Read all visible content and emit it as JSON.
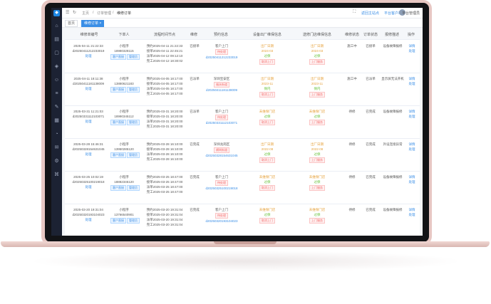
{
  "topbar": {
    "crumb_home": "主页",
    "crumb_sep": "/",
    "crumb_section": "订单管理",
    "crumb_page": "维修订单",
    "right_link_1": "返回主站点",
    "right_link_2": "平台客户端",
    "username": "平台管理员"
  },
  "tabs": [
    {
      "label": "首页"
    },
    {
      "label": "维修订单 ×"
    }
  ],
  "table": {
    "headers": [
      "维修单编号",
      "下单人",
      "流程时间节点",
      "维修",
      "预约信息",
      "设备出厂维保信息",
      "送修门店维保信息",
      "维修状态",
      "订单状态",
      "报修描述",
      "操作"
    ],
    "rows": [
      {
        "order": [
          "2025-04-11 21:22:33",
          "d20250411212233019",
          "处理"
        ],
        "user": [
          "小程序",
          "18980328115",
          "客户直接",
          "管理员"
        ],
        "times": [
          "预约2025-04-11 21:22:33",
          "接单2025-04-11 22:45:21",
          "派单2025-04-12 09:12:10",
          "完工2025-04-12 18:30:02"
        ],
        "repair": "已接单",
        "appt": [
          "客户上门",
          "待处理",
          "d20250411212233019"
        ],
        "factory": [
          "出厂日期",
          "2024-03",
          "过保",
          "取消上门"
        ],
        "store": [
          "出厂日期",
          "2024-03",
          "过保",
          "上门服务"
        ],
        "status": "施工中",
        "ostate": "已接单",
        "desc": "设备故障报修",
        "ops": [
          "详情",
          "处理"
        ]
      },
      {
        "order": [
          "2025-04-11 18:11:38",
          "d20250411181138009",
          "处理"
        ],
        "user": [
          "小程序",
          "13880621183",
          "客户直接",
          "管理员"
        ],
        "times": [
          "预约2025-04-05 18:17:00",
          "接单2025-04-05 18:17:00",
          "派单2025-04-05 18:17:00",
          "完工2025-04-05 18:17:00"
        ],
        "repair": "已派单",
        "appt": [
          "深圳宝安区",
          "福永街道",
          "d20250411181138009"
        ],
        "factory": [
          "出厂日期",
          "2023-11",
          "保内",
          "取消上门"
        ],
        "store": [
          "出厂日期",
          "2023-11",
          "保内",
          "上门服务"
        ],
        "status": "施工中",
        "ostate": "已派单",
        "desc": "显示屏无法开机",
        "ops": [
          "详情",
          "处理"
        ]
      },
      {
        "order": [
          "2025-03-31 11:21:03",
          "d20250331112103071",
          "处理"
        ],
        "user": [
          "小程序",
          "18990345112",
          "客户直接",
          "管理员"
        ],
        "times": [
          "预约2025-03-31 18:20:00",
          "接单2025-03-31 18:20:00",
          "派单2025-03-31 18:20:00",
          "完工2025-03-31 18:20:00"
        ],
        "repair": "已派单",
        "appt": [
          "客户上门",
          "待处理",
          "d20250331112103071"
        ],
        "factory": [
          "未维保门店",
          "过保",
          "取消上门"
        ],
        "store": [
          "未维保门店",
          "过保",
          "上门服务"
        ],
        "status": "待修",
        "ostate": "已完成",
        "desc": "设备故障报修",
        "ops": [
          "详情",
          "处理"
        ]
      },
      {
        "order": [
          "2025-03-28 15:46:31",
          "d20250328154631045",
          "处理"
        ],
        "user": [
          "小程序",
          "13950285120",
          "客户直接",
          "管理员"
        ],
        "times": [
          "预约2025-03-28 16:10:00",
          "接单2025-03-28 16:10:00",
          "派单2025-03-28 16:10:00",
          "完工2025-03-28 16:10:00"
        ],
        "repair": "已完成",
        "appt": [
          "深圳龙岗区",
          "横岗街道",
          "d20250328154631045"
        ],
        "factory": [
          "出厂日期",
          "2022-08",
          "过保",
          "取消上门"
        ],
        "store": [
          "出厂日期",
          "2022-08",
          "过保",
          "上门服务"
        ],
        "status": "待修",
        "ostate": "已完成",
        "desc": "外设连接异常",
        "ops": [
          "详情",
          "处理"
        ]
      },
      {
        "order": [
          "2025-03-25 10:02:19",
          "d20250325100219018",
          "处理"
        ],
        "user": [
          "小程序",
          "18882345120",
          "客户直接",
          "管理员"
        ],
        "times": [
          "预约2025-03-25 18:47:00",
          "接单2025-03-25 18:47:00",
          "派单2025-03-25 18:47:00",
          "完工2025-03-25 18:47:00"
        ],
        "repair": "已完成",
        "appt": [
          "客户上门",
          "待处理",
          "d20250325100219018"
        ],
        "factory": [
          "未维保门店",
          "过保",
          "取消上门"
        ],
        "store": [
          "未维保门店",
          "过保",
          "上门服务"
        ],
        "status": "待修",
        "ostate": "已完成",
        "desc": "设备故障报修",
        "ops": [
          "详情",
          "处理"
        ]
      },
      {
        "order": [
          "2025-03-20 19:31:04",
          "d20250320193104023",
          "处理"
        ],
        "user": [
          "小程序",
          "13766540901",
          "客户直接",
          "管理员"
        ],
        "times": [
          "预约2025-03-20 19:31:04",
          "接单2025-03-20 19:31:04",
          "派单2025-03-20 19:31:04",
          "完工2025-03-20 19:31:04"
        ],
        "repair": "已完成",
        "appt": [
          "客户上门",
          "待处理",
          "d20250320193104023"
        ],
        "factory": [
          "未维保门店",
          "过保",
          "取消上门"
        ],
        "store": [
          "未维保门店",
          "过保",
          "上门服务"
        ],
        "status": "待修",
        "ostate": "已完成",
        "desc": "设备故障报修",
        "ops": [
          "详情",
          "处理"
        ]
      }
    ]
  },
  "sidebar": {
    "icons": [
      "home-icon",
      "order-icon",
      "device-icon",
      "shield-icon",
      "user-icon",
      "list-icon",
      "tool-icon",
      "store-icon",
      "chart-icon",
      "message-icon",
      "setting-icon",
      "lock-icon"
    ]
  }
}
